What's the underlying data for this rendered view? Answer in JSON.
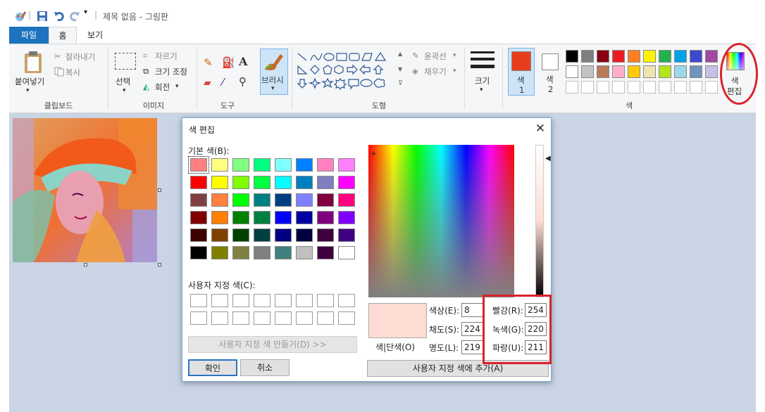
{
  "window": {
    "title": "제목 없음 - 그림판"
  },
  "tabs": {
    "file": "파일",
    "home": "홈",
    "view": "보기"
  },
  "clipboard": {
    "paste": "붙여넣기",
    "cut": "잘라내기",
    "copy": "복사",
    "group": "클립보드"
  },
  "image_group": {
    "select": "선택",
    "crop": "자르기",
    "resize": "크기 조정",
    "rotate": "회전",
    "group": "이미지"
  },
  "tools": {
    "group": "도구",
    "text_tool": "A"
  },
  "brushes": {
    "label": "브러시"
  },
  "shapes": {
    "outline": "윤곽선",
    "fill": "채우기",
    "group": "도형"
  },
  "size": {
    "label": "크기"
  },
  "colors": {
    "color1": "색",
    "color1_num": "1",
    "color2": "색",
    "color2_num": "2",
    "edit_colors_1": "색",
    "edit_colors_2": "편집",
    "group": "색",
    "color1_value": "#e83d1c",
    "color2_value": "#ffffff",
    "palette_row1": [
      "#000000",
      "#7f7f7f",
      "#880015",
      "#ed1c24",
      "#ff7f27",
      "#fff200",
      "#22b14c",
      "#00a2e8",
      "#3f48cc",
      "#a349a4"
    ],
    "palette_row2": [
      "#ffffff",
      "#c3c3c3",
      "#b97a57",
      "#ffaec9",
      "#ffc90e",
      "#efe4b0",
      "#b5e61d",
      "#99d9ea",
      "#7092be",
      "#c8bfe7"
    ]
  },
  "dialog": {
    "title": "색 편집",
    "close": "✕",
    "basic_colors_label": "기본 색(B):",
    "basic_colors": [
      "#ff8080",
      "#ffff80",
      "#80ff80",
      "#00ff80",
      "#80ffff",
      "#0080ff",
      "#ff80c0",
      "#ff80ff",
      "#ff0000",
      "#ffff00",
      "#80ff00",
      "#00ff40",
      "#00ffff",
      "#0080c0",
      "#8080c0",
      "#ff00ff",
      "#804040",
      "#ff8040",
      "#00ff00",
      "#008080",
      "#004080",
      "#8080ff",
      "#800040",
      "#ff0080",
      "#800000",
      "#ff8000",
      "#008000",
      "#008040",
      "#0000ff",
      "#0000a0",
      "#800080",
      "#8000ff",
      "#400000",
      "#804000",
      "#004000",
      "#004040",
      "#000080",
      "#000040",
      "#400040",
      "#400080",
      "#000000",
      "#808000",
      "#808040",
      "#808080",
      "#408080",
      "#c0c0c0",
      "#400040",
      "#ffffff"
    ],
    "custom_colors_label": "사용자 지정 색(C):",
    "define_custom": "사용자 지정 색 만들기(D) >>",
    "ok": "확인",
    "cancel": "취소",
    "solid_label": "색|단색(O)",
    "hue_label": "색상(E):",
    "hue": "8",
    "sat_label": "채도(S):",
    "sat": "224",
    "lum_label": "명도(L):",
    "lum": "219",
    "red_label": "빨강(R):",
    "red": "254",
    "green_label": "녹색(G):",
    "green": "220",
    "blue_label": "파랑(U):",
    "blue": "211",
    "add_custom": "사용자 지정 색에 추가(A)"
  }
}
